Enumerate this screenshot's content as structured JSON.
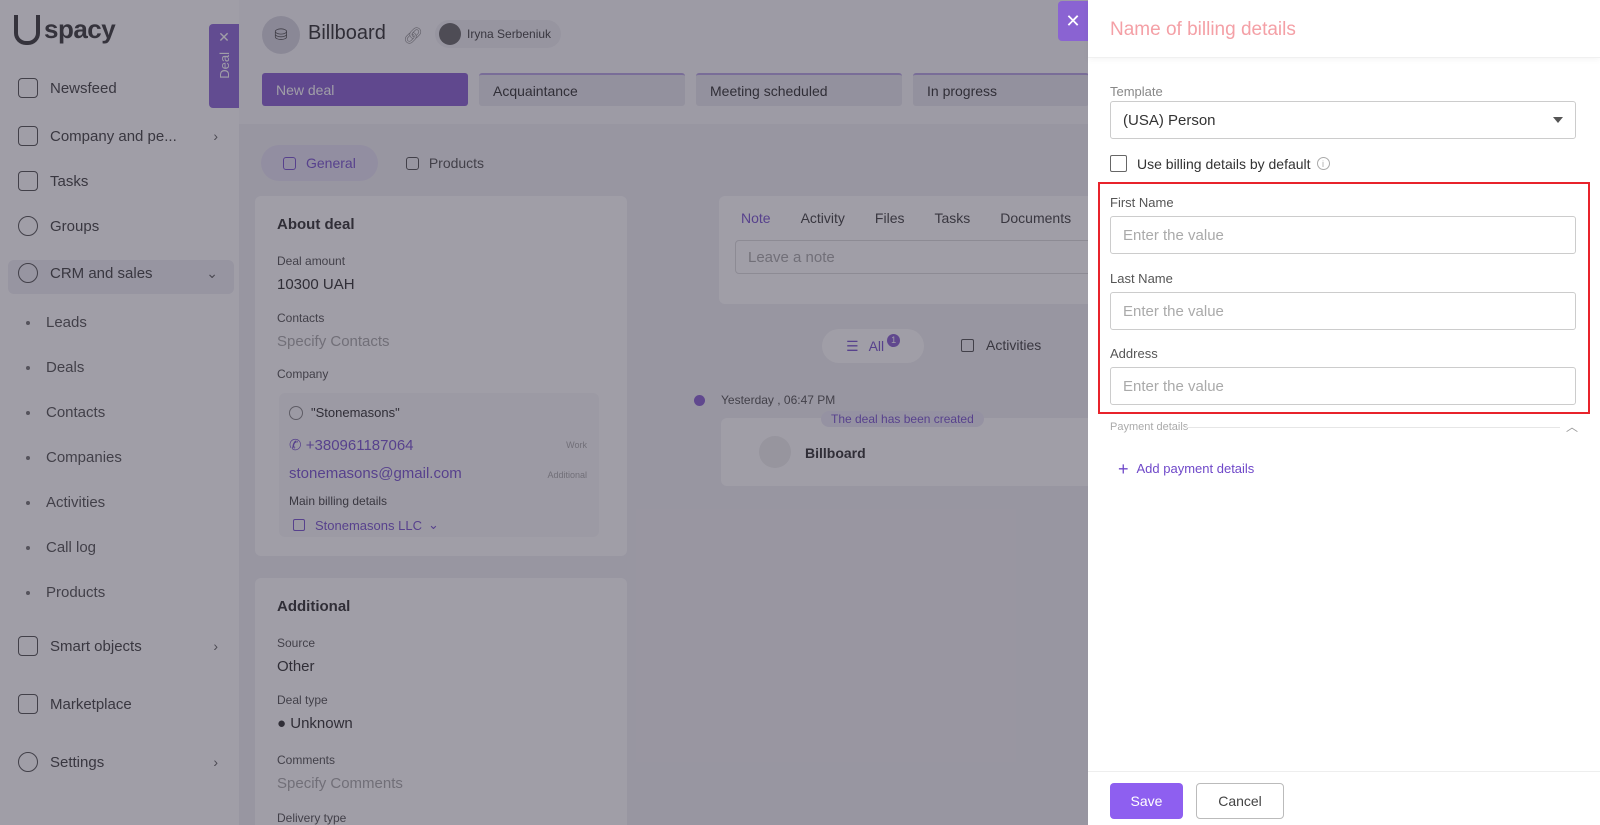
{
  "sidebar": {
    "logo": "spacy",
    "items": [
      {
        "label": "Newsfeed",
        "icon": "home-icon"
      },
      {
        "label": "Company and pe...",
        "icon": "building-icon"
      },
      {
        "label": "Tasks",
        "icon": "calendar-icon"
      },
      {
        "label": "Groups",
        "icon": "users-icon"
      },
      {
        "label": "CRM and sales",
        "icon": "crm-icon"
      },
      {
        "label": "Smart objects",
        "icon": "smart-objects-icon"
      },
      {
        "label": "Marketplace",
        "icon": "marketplace-icon"
      },
      {
        "label": "Settings",
        "icon": "gear-icon"
      }
    ],
    "crm_sub": [
      "Leads",
      "Deals",
      "Contacts",
      "Companies",
      "Activities",
      "Call log",
      "Products"
    ],
    "deal_tab": "Deal"
  },
  "deal": {
    "title": "Billboard",
    "owner": "Iryna Serbeniuk",
    "stages": [
      "New deal",
      "Acquaintance",
      "Meeting scheduled",
      "In progress"
    ],
    "tabs": [
      "General",
      "Products"
    ],
    "about": {
      "heading": "About deal",
      "amount_label": "Deal amount",
      "amount_value": "10300 UAH",
      "contacts_label": "Contacts",
      "contacts_placeholder": "Specify Contacts",
      "company_label": "Company",
      "company_name": "\"Stonemasons\"",
      "phone": "+380961187064",
      "phone_tag": "Work",
      "email": "stonemasons@gmail.com",
      "email_tag": "Additional",
      "billing_label": "Main billing details",
      "billing_value": "Stonemasons LLC"
    },
    "additional": {
      "heading": "Additional",
      "source_label": "Source",
      "source_value": "Other",
      "type_label": "Deal type",
      "type_value": "Unknown",
      "comments_label": "Comments",
      "comments_placeholder": "Specify Comments",
      "delivery_label": "Delivery type"
    },
    "activity_tabs": [
      "Note",
      "Activity",
      "Files",
      "Tasks",
      "Documents"
    ],
    "note_placeholder": "Leave a note",
    "filter_all": "All",
    "filter_badge": "1",
    "filter_activities": "Activities",
    "timeline_time": "Yesterday , 06:47 PM",
    "timeline_tag": "The deal has been created",
    "timeline_name": "Billboard"
  },
  "drawer": {
    "title": "Name of billing details",
    "template_label": "Template",
    "template_value": "(USA) Person",
    "default_checkbox_label": "Use billing details by default",
    "fields": [
      {
        "label": "First Name",
        "placeholder": "Enter the value"
      },
      {
        "label": "Last Name",
        "placeholder": "Enter the value"
      },
      {
        "label": "Address",
        "placeholder": "Enter the value"
      }
    ],
    "payment_section": "Payment details",
    "add_payment": "Add payment details",
    "save": "Save",
    "cancel": "Cancel"
  },
  "colors": {
    "accent": "#8a63d2",
    "highlight": "#e8232b",
    "drawer_title": "#f4a0a6"
  }
}
